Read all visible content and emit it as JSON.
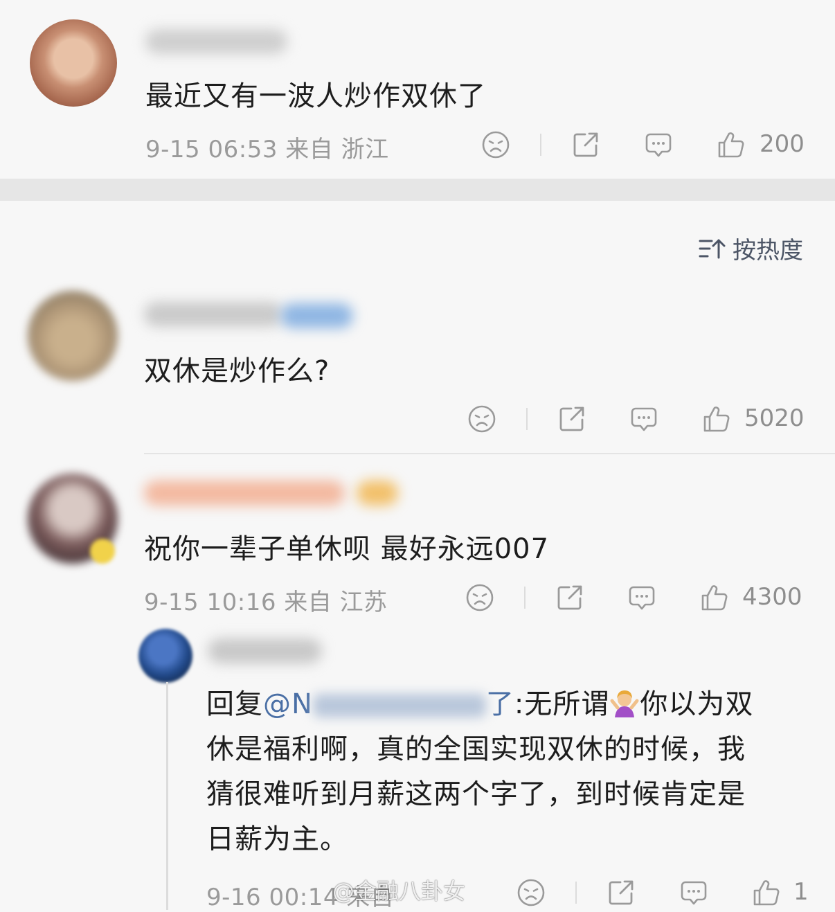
{
  "top_comment": {
    "text": "最近又有一波人炒作双休了",
    "meta": "9-15 06:53 来自 浙江",
    "likes": "200"
  },
  "sort": {
    "label": "按热度"
  },
  "comments": [
    {
      "text": "双休是炒作么?",
      "likes": "5020"
    },
    {
      "text": "祝你一辈子单休呗 最好永远007",
      "meta": "9-15 10:16 来自 江苏",
      "likes": "4300"
    }
  ],
  "reply": {
    "prefix": "回复",
    "mention_start": "@N",
    "mention_end": "了",
    "line1_rest": ":无所谓",
    "line1_tail": "你以为双",
    "line2": "休是福利啊，真的全国实现双休的时候，我",
    "line3": "猜很难听到月薪这两个字了，到时候肯定是",
    "line4": "日薪为主。",
    "meta": "9-16 00:14 来自",
    "likes": "1"
  },
  "watermark": "@金融八卦女",
  "icons": {
    "dislike": "sad-face-icon",
    "share": "share-icon",
    "comment": "comment-bubble-icon",
    "like": "thumbs-up-icon",
    "sort": "sort-icon"
  },
  "colors": {
    "background": "#f7f7f7",
    "separator_band": "#e6e6e6",
    "meta_text": "#9a9a9a",
    "mention": "#4a6fa5"
  }
}
